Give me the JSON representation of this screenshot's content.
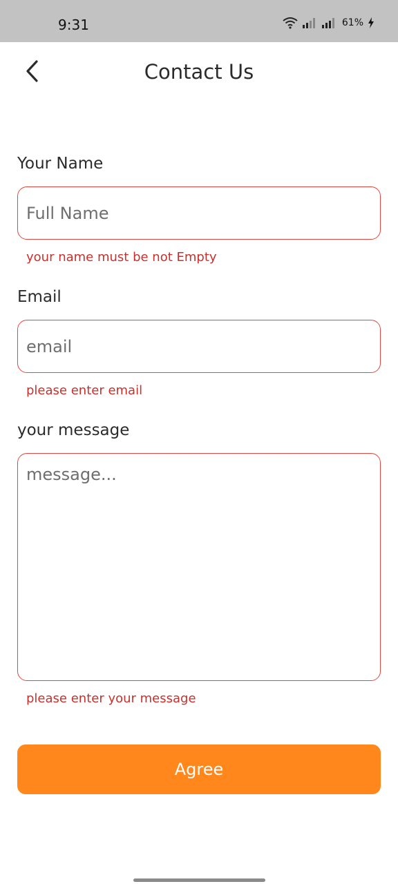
{
  "status_bar": {
    "time": "9:31",
    "battery": "61%",
    "icons": [
      "wifi-icon",
      "signal-icon",
      "signal-icon",
      "battery-charging-icon"
    ]
  },
  "header": {
    "title": "Contact Us",
    "back_icon": "chevron-left-icon"
  },
  "form": {
    "name": {
      "label": "Your Name",
      "placeholder": "Full Name",
      "value": "",
      "error": "your name must be not Empty"
    },
    "email": {
      "label": "Email",
      "placeholder": "email",
      "value": "",
      "error": "please enter email"
    },
    "message": {
      "label": "your message",
      "placeholder": "message...",
      "value": "",
      "error": "please enter your message"
    },
    "submit_label": "Agree"
  },
  "colors": {
    "accent": "#ff871c",
    "error": "#c9302c",
    "error_border": "#e0473e",
    "status_bar": "#c2c2c2"
  }
}
